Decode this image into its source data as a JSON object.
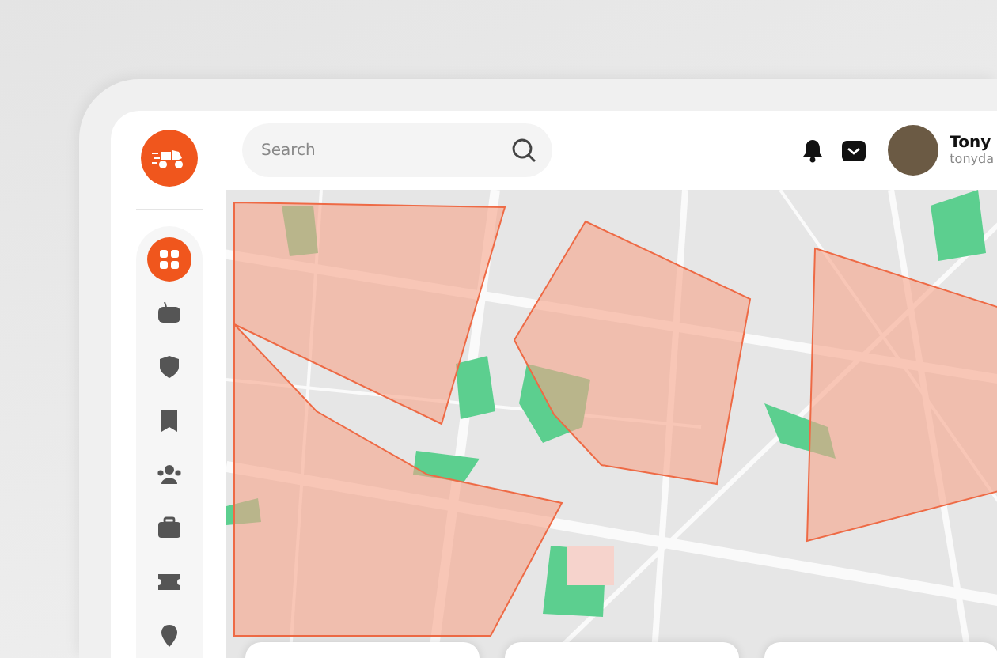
{
  "sidebar": {
    "items": [
      {
        "selected": true
      },
      {
        "selected": false
      },
      {
        "selected": false
      },
      {
        "selected": false
      },
      {
        "selected": false
      },
      {
        "selected": false
      },
      {
        "selected": false
      },
      {
        "selected": false
      }
    ]
  },
  "header": {
    "search": {
      "placeholder": "Search"
    },
    "user": {
      "name": "Tony",
      "email": "tonyda"
    }
  }
}
